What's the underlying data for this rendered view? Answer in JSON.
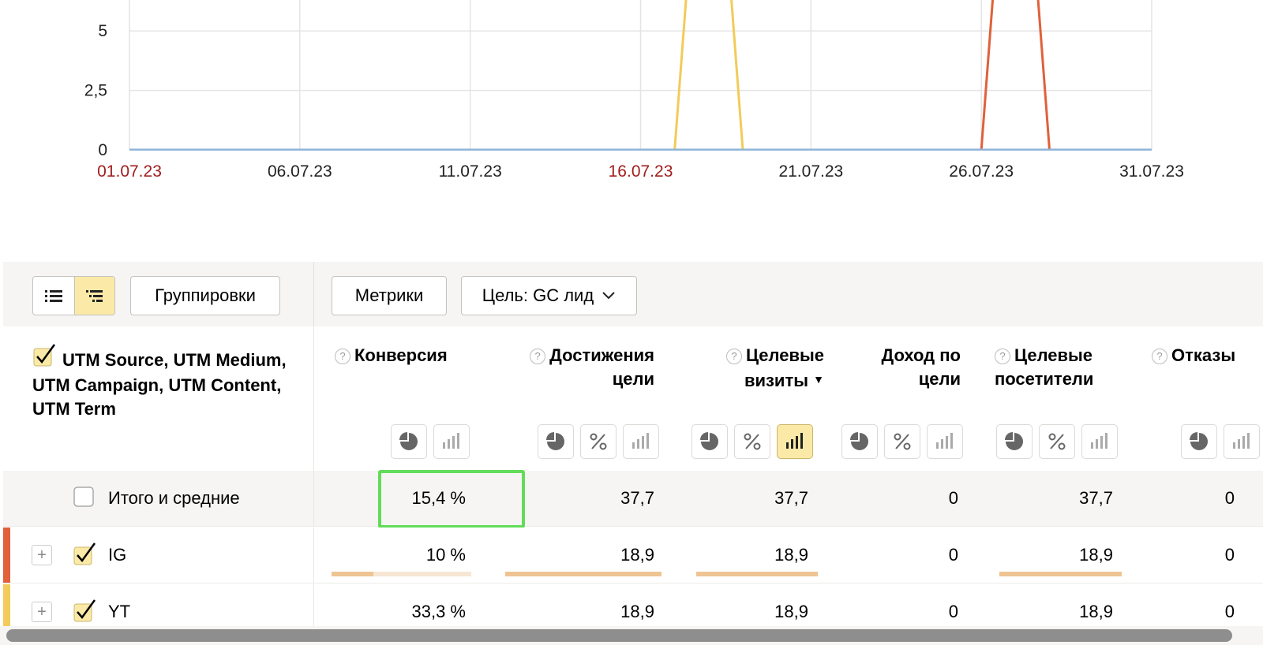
{
  "chart_data": {
    "type": "line",
    "title": "",
    "x": [
      "01.07.23",
      "02.07.23",
      "03.07.23",
      "04.07.23",
      "05.07.23",
      "06.07.23",
      "07.07.23",
      "08.07.23",
      "09.07.23",
      "10.07.23",
      "11.07.23",
      "12.07.23",
      "13.07.23",
      "14.07.23",
      "15.07.23",
      "16.07.23",
      "17.07.23",
      "18.07.23",
      "19.07.23",
      "20.07.23",
      "21.07.23",
      "22.07.23",
      "23.07.23",
      "24.07.23",
      "25.07.23",
      "26.07.23",
      "27.07.23",
      "28.07.23",
      "29.07.23",
      "30.07.23",
      "31.07.23"
    ],
    "x_tick_labels": [
      "01.07.23",
      "06.07.23",
      "11.07.23",
      "16.07.23",
      "21.07.23",
      "26.07.23",
      "31.07.23"
    ],
    "weekend_tick_labels": [
      "01.07.23",
      "16.07.23"
    ],
    "y_tick_labels": [
      "0",
      "2,5",
      "5"
    ],
    "y_ticks": [
      0,
      2.5,
      5
    ],
    "ylim": [
      0,
      6.3
    ],
    "grid": true,
    "series": [
      {
        "color": "#f2cb5a",
        "values": [
          0,
          0,
          0,
          0,
          0,
          0,
          0,
          0,
          0,
          0,
          0,
          0,
          0,
          0,
          0,
          0,
          0,
          18.9,
          0,
          0,
          0,
          0,
          0,
          0,
          0,
          0,
          0,
          0,
          0,
          0,
          0
        ]
      },
      {
        "color": "#e0613a",
        "values": [
          0,
          0,
          0,
          0,
          0,
          0,
          0,
          0,
          0,
          0,
          0,
          0,
          0,
          0,
          0,
          0,
          0,
          0,
          0,
          0,
          0,
          0,
          0,
          0,
          0,
          0,
          18.9,
          0,
          0,
          0,
          0
        ]
      },
      {
        "color": "#8fb4d8",
        "values": [
          0,
          0,
          0,
          0,
          0,
          0,
          0,
          0,
          0,
          0,
          0,
          0,
          0,
          0,
          0,
          0,
          0,
          0,
          0,
          0,
          0,
          0,
          0,
          0,
          0,
          0,
          0,
          0,
          0,
          0,
          0
        ]
      }
    ]
  },
  "toolbar": {
    "view_list_icon": "list-icon",
    "view_tree_icon": "tree-list-icon",
    "groupings_label": "Группировки",
    "metrics_label": "Метрики",
    "goal_label": "Цель: GC лид"
  },
  "table": {
    "dimension_title": "UTM Source, UTM Medium, UTM Campaign, UTM Content, UTM Term",
    "columns": [
      {
        "label": "Конверсия",
        "help": "?"
      },
      {
        "label": "Достижения цели",
        "help": "?"
      },
      {
        "label": "Целевые визиты",
        "help": "?",
        "sort": "▼"
      },
      {
        "label": "Доход по цели"
      },
      {
        "label": "Целевые посетители",
        "help": "?"
      },
      {
        "label": "Отказы",
        "help": "?"
      }
    ],
    "rows": [
      {
        "label": "Итого и средние",
        "checked": false,
        "values": [
          "15,4 %",
          "37,7",
          "37,7",
          "0",
          "37,7",
          "0"
        ]
      },
      {
        "label": "IG",
        "checked": true,
        "color": "#e0613a",
        "values": [
          "10 %",
          "18,9",
          "18,9",
          "0",
          "18,9",
          "0"
        ],
        "bars": [
          0.3,
          1,
          1,
          0,
          1
        ]
      },
      {
        "label": "YT",
        "checked": true,
        "color": "#f2cb5a",
        "values": [
          "33,3 %",
          "18,9",
          "18,9",
          "0",
          "18,9",
          "0"
        ]
      }
    ]
  },
  "colors": {
    "accent_yellow": "#fbeaa7",
    "highlight_green": "#62dc5a",
    "weekend_red": "#a01d1d"
  }
}
